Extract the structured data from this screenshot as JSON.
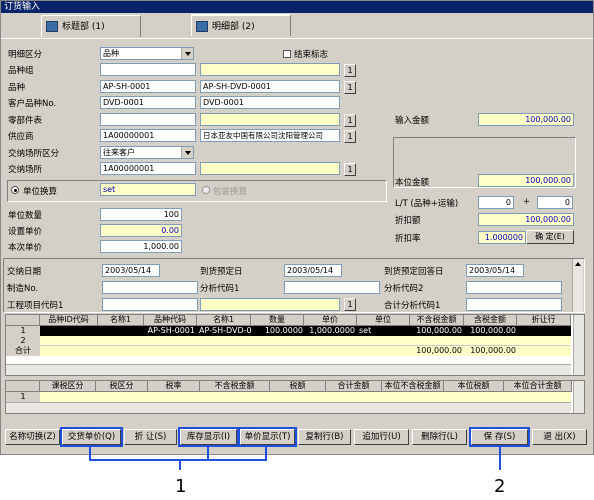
{
  "window": {
    "title": "订货输入"
  },
  "tabs": [
    {
      "label": "标题部 (1)"
    },
    {
      "label": "明细部 (2)"
    }
  ],
  "top": {
    "detail_class_label": "明细区分",
    "detail_class_value": "品种",
    "end_flag_label": "结束标志",
    "item_group_label": "品种组",
    "item_label": "品种",
    "item_code": "AP-SH-0001",
    "item_name": "AP-SH-DVD-0001",
    "cust_item_label": "客户品种No.",
    "cust_item_code": "DVD-0001",
    "cust_item_name": "DVD-0001",
    "parts_label": "零部件表",
    "supplier_label": "供应商",
    "supplier_code": "1A00000001",
    "supplier_name": "日本亚友中国有限公司沈阳管理公司",
    "delivery_place_class_label": "交纳场所区分",
    "delivery_place_class_value": "往来客户",
    "delivery_place_label": "交纳场所",
    "delivery_place_code": "1A00000001",
    "input_amount_label": "输入金额",
    "input_amount_value": "100,000.00",
    "local_amount_label": "本位金额",
    "local_amount_value": "100,000.00",
    "unit_conv_label": "单位换算",
    "unit_conv_value": "set",
    "pack_conv_label": "包装换算",
    "unit_qty_label": "单位数量",
    "unit_qty_value": "100",
    "set_unit_price_label": "设置单价",
    "set_unit_price_value": "0.00",
    "this_unit_price_label": "本次单价",
    "this_unit_price_value": "1,000.00",
    "lt_label": "L/T (品种+运输)",
    "lt_value1": "0",
    "lt_plus": "+",
    "lt_value2": "0",
    "discount_amount_label": "折扣额",
    "discount_amount_value": "100,000.00",
    "discount_rate_label": "折扣率",
    "discount_rate_value": "1.000000",
    "confirm_btn": "确 定(E)",
    "one": "1"
  },
  "mid": {
    "trade_date_label": "交纳日期",
    "trade_date_value": "2003/05/14",
    "arrival_date_label": "到货预定日",
    "arrival_date_value": "2003/05/14",
    "arrival_reply_label": "到货预定回答日",
    "arrival_reply_value": "2003/05/14",
    "mfg_no_label": "制造No.",
    "analysis1_label": "分析代码1",
    "analysis2_label": "分析代码2",
    "project_label": "工程项目代码1",
    "total_analysis_label": "合计分析代码1",
    "one": "1"
  },
  "grid1": {
    "headers": [
      "品种ID代码",
      "名称1",
      "品种代码",
      "名称1",
      "数量",
      "单价",
      "单位",
      "不含税金额",
      "含税金额",
      "折让行"
    ],
    "rows": [
      {
        "no": "1",
        "cells": [
          "",
          "",
          "AP-SH-0001",
          "AP-SH-DVD-000",
          "100.0000",
          "1,000.0000",
          "set",
          "100,000.00",
          "100,000.00",
          ""
        ]
      },
      {
        "no": "2",
        "cells": [
          "",
          "",
          "",
          "",
          "",
          "",
          "",
          "",
          "",
          ""
        ]
      }
    ],
    "total_label": "合计",
    "total_excl": "100,000.00",
    "total_incl": "100,000.00"
  },
  "grid2": {
    "headers": [
      "课税区分",
      "税区分",
      "税率",
      "不含税金额",
      "税额",
      "合计金额",
      "本位不含税金额",
      "本位税额",
      "本位合计金额"
    ],
    "row_no": "1"
  },
  "buttons": [
    {
      "label": "名称切换(Z)"
    },
    {
      "label": "交货单价(Q)"
    },
    {
      "label": "折  让(S)"
    },
    {
      "label": "库存显示(I)"
    },
    {
      "label": "单价显示(T)"
    },
    {
      "label": "复制行(B)"
    },
    {
      "label": "追加行(U)"
    },
    {
      "label": "删除行(L)"
    },
    {
      "label": "保  存(S)"
    },
    {
      "label": "退  出(X)"
    }
  ],
  "callouts": {
    "c1": "1",
    "c2": "2"
  }
}
